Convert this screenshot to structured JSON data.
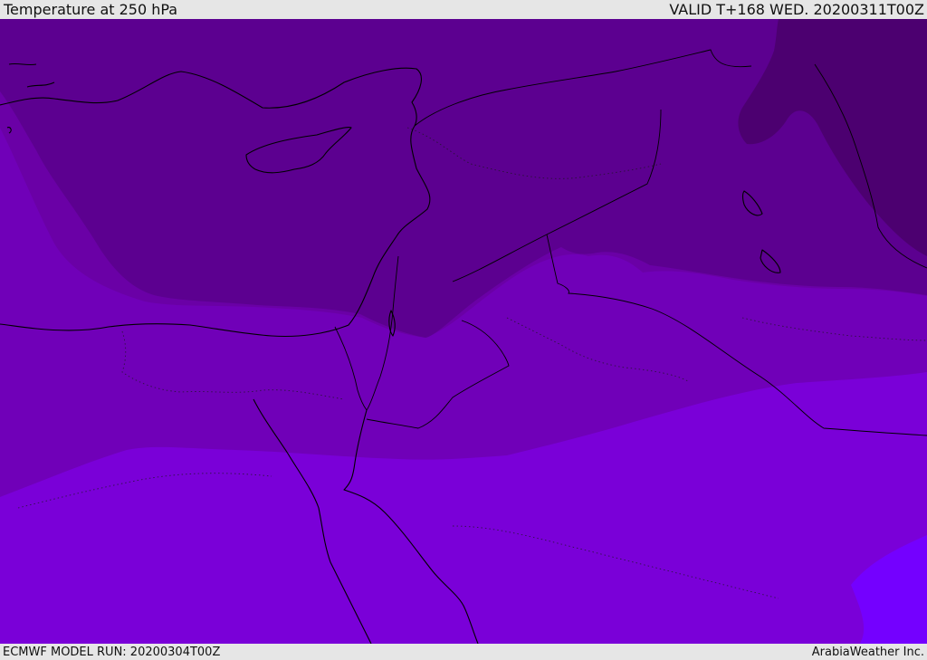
{
  "header": {
    "title": "Temperature at 250 hPa",
    "valid_time": "VALID T+168 WED. 20200311T00Z"
  },
  "footer": {
    "model_run": "ECMWF MODEL RUN: 20200304T00Z",
    "credit": "ArabiaWeather Inc."
  },
  "map": {
    "field": "temperature-250hpa",
    "band_colors": [
      "#4c0070",
      "#5c0090",
      "#6a00a6",
      "#7000b8",
      "#7a00d8",
      "#7400ff"
    ],
    "coastline_color": "#000000"
  }
}
